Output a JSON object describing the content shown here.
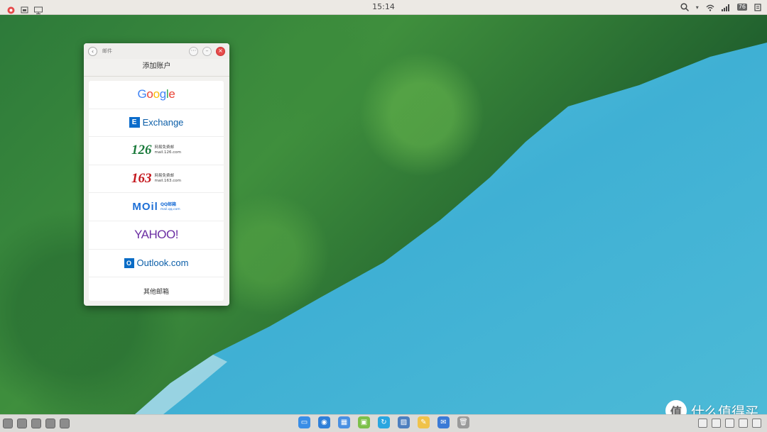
{
  "topbar": {
    "time": "15:14",
    "battery": "76"
  },
  "window": {
    "title": "邮件",
    "header": "添加账户",
    "accounts": [
      {
        "id": "google",
        "label": "Google"
      },
      {
        "id": "exchange",
        "label": "Exchange"
      },
      {
        "id": "126",
        "number": "126",
        "line1": "网易免费邮",
        "line2": "mail.126.com"
      },
      {
        "id": "163",
        "number": "163",
        "line1": "网易免费邮",
        "line2": "mail.163.com"
      },
      {
        "id": "qq",
        "label": "MOil",
        "line1": "QQ邮箱",
        "line2": "mail.qq.com"
      },
      {
        "id": "yahoo",
        "label": "YAHOO!"
      },
      {
        "id": "outlook",
        "label": "Outlook.com"
      },
      {
        "id": "other",
        "label": "其他邮箱"
      }
    ]
  },
  "watermark": {
    "glyph": "值",
    "text": "什么值得买"
  },
  "colors": {
    "water": "#44b7d8",
    "forest": "#2d7a3a",
    "close": "#e54b4b",
    "netease_126": "#1a7a3b",
    "netease_163": "#c4161c",
    "yahoo": "#6b2ea3"
  }
}
